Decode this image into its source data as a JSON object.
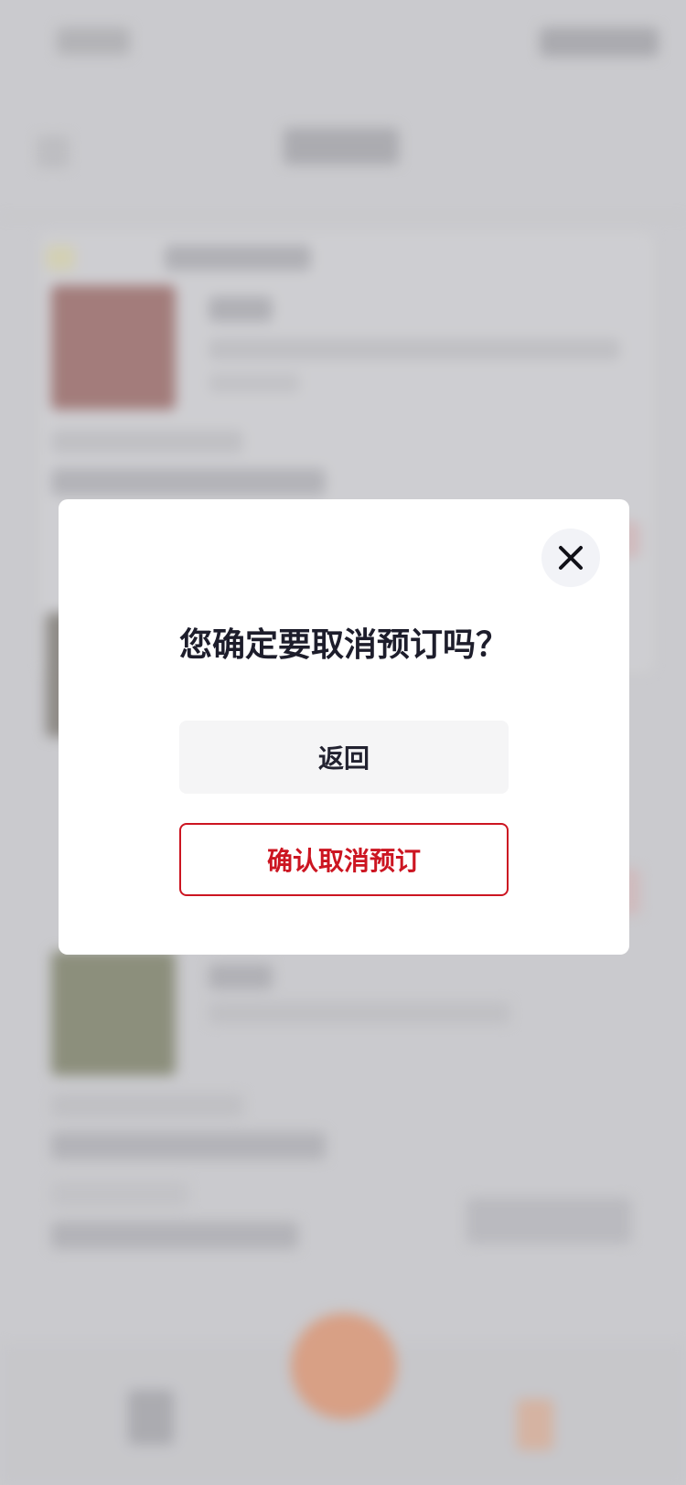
{
  "dialog": {
    "title": "您确定要取消预订吗？",
    "back_label": "返回",
    "confirm_label": "确认取消预订",
    "close_icon": "close-icon"
  },
  "colors": {
    "accent_red": "#cc1521",
    "fab_orange": "#e08a60",
    "scrim": "#cbcbcf"
  }
}
